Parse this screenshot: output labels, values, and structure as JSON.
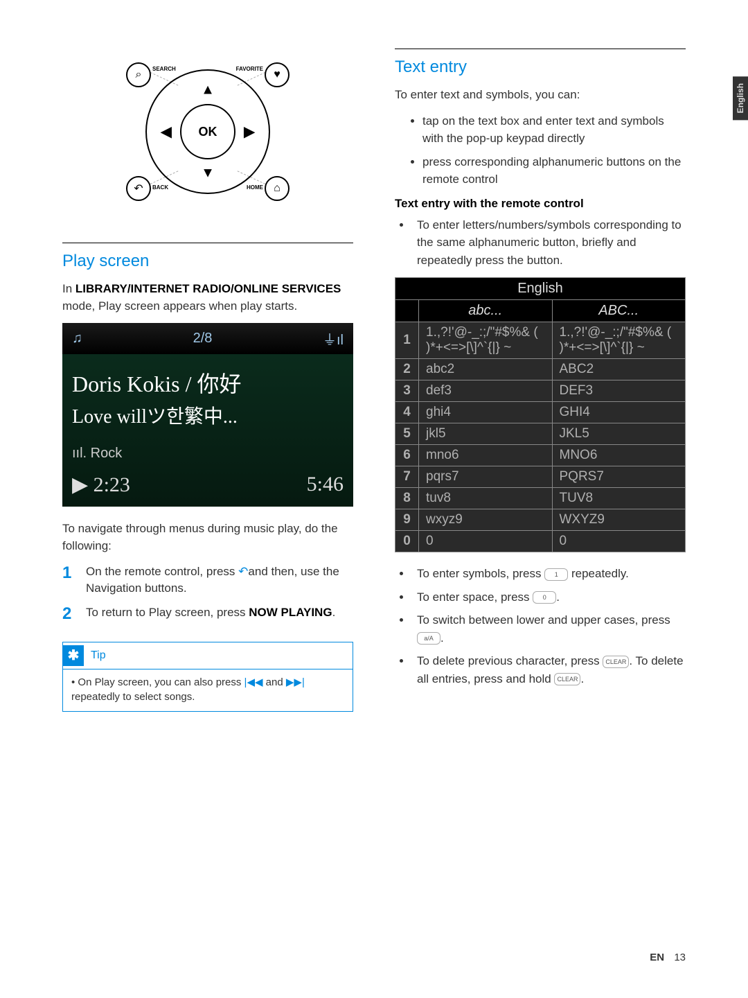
{
  "language_tab": "English",
  "page_footer": {
    "lang": "EN",
    "num": "13"
  },
  "remote": {
    "ok": "OK",
    "search_label": "SEARCH",
    "favorite_label": "FAVORITE",
    "back_label": "BACK",
    "home_label": "HOME"
  },
  "left": {
    "heading": "Play screen",
    "intro_prefix": "In ",
    "intro_bold": "LIBRARY/INTERNET RADIO/ONLINE SERVICES",
    "intro_suffix": " mode, Play screen appears when play starts.",
    "player": {
      "counter": "2/8",
      "line1": "Doris Kokis / 你好",
      "line2": "Love willツ한繁中...",
      "genre_prefix": "Rock",
      "elapsed": "2:23",
      "total": "5:46"
    },
    "nav_intro": "To navigate through menus during music play, do the following:",
    "step1_a": "On the remote control, press ",
    "step1_b": "and then, use the Navigation buttons.",
    "step2_a": "To return to Play screen, press ",
    "step2_bold": "NOW PLAYING",
    "step2_c": ".",
    "tip_label": "Tip",
    "tip_body_a": "On Play screen, you can also press ",
    "tip_body_b": " and ",
    "tip_body_c": " repeatedly to select songs."
  },
  "right": {
    "heading": "Text entry",
    "intro": "To enter text and symbols, you can:",
    "bullets": [
      "tap on the text box and enter text and symbols with the pop-up keypad directly",
      "press corresponding alphanumeric buttons on the remote control"
    ],
    "sub_heading": "Text entry with the remote control",
    "sub_bullet": "To enter letters/numbers/symbols corresponding to the same alphanumeric button, briefly and repeatedly press the button.",
    "table": {
      "title": "English",
      "col_abc": "abc...",
      "col_ABC": "ABC...",
      "rows": [
        {
          "k": "1",
          "lc": "1.,?!'@-_:;/\"#$%& ( )*+<=>[\\]^`{|} ~",
          "uc": "1.,?!'@-_:;/\"#$%& ( )*+<=>[\\]^`{|} ~"
        },
        {
          "k": "2",
          "lc": "abc2",
          "uc": "ABC2"
        },
        {
          "k": "3",
          "lc": "def3",
          "uc": "DEF3"
        },
        {
          "k": "4",
          "lc": "ghi4",
          "uc": "GHI4"
        },
        {
          "k": "5",
          "lc": "jkl5",
          "uc": "JKL5"
        },
        {
          "k": "6",
          "lc": "mno6",
          "uc": "MNO6"
        },
        {
          "k": "7",
          "lc": "pqrs7",
          "uc": "PQRS7"
        },
        {
          "k": "8",
          "lc": "tuv8",
          "uc": "TUV8"
        },
        {
          "k": "9",
          "lc": "wxyz9",
          "uc": "WXYZ9"
        },
        {
          "k": "0",
          "lc": " 0",
          "uc": " 0"
        }
      ]
    },
    "tips": {
      "symbols_a": "To enter symbols, press ",
      "symbols_key": "1",
      "symbols_b": " repeatedly.",
      "space_a": "To enter space, press ",
      "space_key": "0",
      "space_b": ".",
      "case_a": "To switch between lower and upper cases, press ",
      "case_key": "a/A",
      "case_b": ".",
      "delete_a": "To delete previous character, press ",
      "delete_key1": "CLEAR",
      "delete_b": ". To delete all entries, press and hold ",
      "delete_key2": "CLEAR",
      "delete_c": "."
    }
  }
}
